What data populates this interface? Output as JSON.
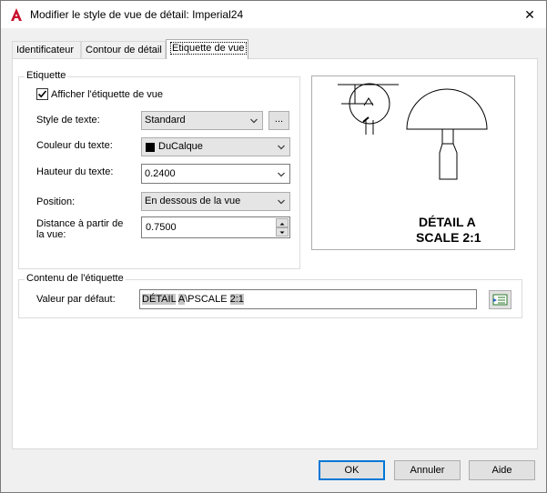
{
  "window": {
    "title": "Modifier le style de vue de détail: Imperial24",
    "close_label": "✕"
  },
  "tabs": [
    {
      "label": "Identificateur",
      "active": false
    },
    {
      "label": "Contour de détail",
      "active": false
    },
    {
      "label": "Etiquette de vue",
      "active": true
    }
  ],
  "etiquette": {
    "group_label": "Etiquette",
    "show_label_text": "Afficher l'étiquette de vue",
    "show_label_checked": true,
    "text_style": {
      "label": "Style de texte:",
      "value": "Standard",
      "browse_label": "..."
    },
    "text_color": {
      "label": "Couleur du texte:",
      "value": "DuCalque",
      "swatch_color": "#000000"
    },
    "text_height": {
      "label": "Hauteur du texte:",
      "value": "0.2400"
    },
    "position": {
      "label": "Position:",
      "value": "En dessous de la vue"
    },
    "distance": {
      "label": "Distance à partir de la vue:",
      "value": "0.7500"
    }
  },
  "preview": {
    "title_line1": "DÉTAIL A",
    "title_line2": "SCALE 2:1"
  },
  "contenu": {
    "group_label": "Contenu de l'étiquette",
    "default_label": "Valeur par défaut:",
    "value_part1": "DÉTAIL",
    "value_part2": " ",
    "value_part3": "A",
    "value_part4": "\\PSCALE ",
    "value_part5": "2:1"
  },
  "buttons": {
    "ok": "OK",
    "cancel": "Annuler",
    "help": "Aide"
  },
  "colors": {
    "accent": "#0078d7",
    "app_icon": "#c8102e"
  }
}
